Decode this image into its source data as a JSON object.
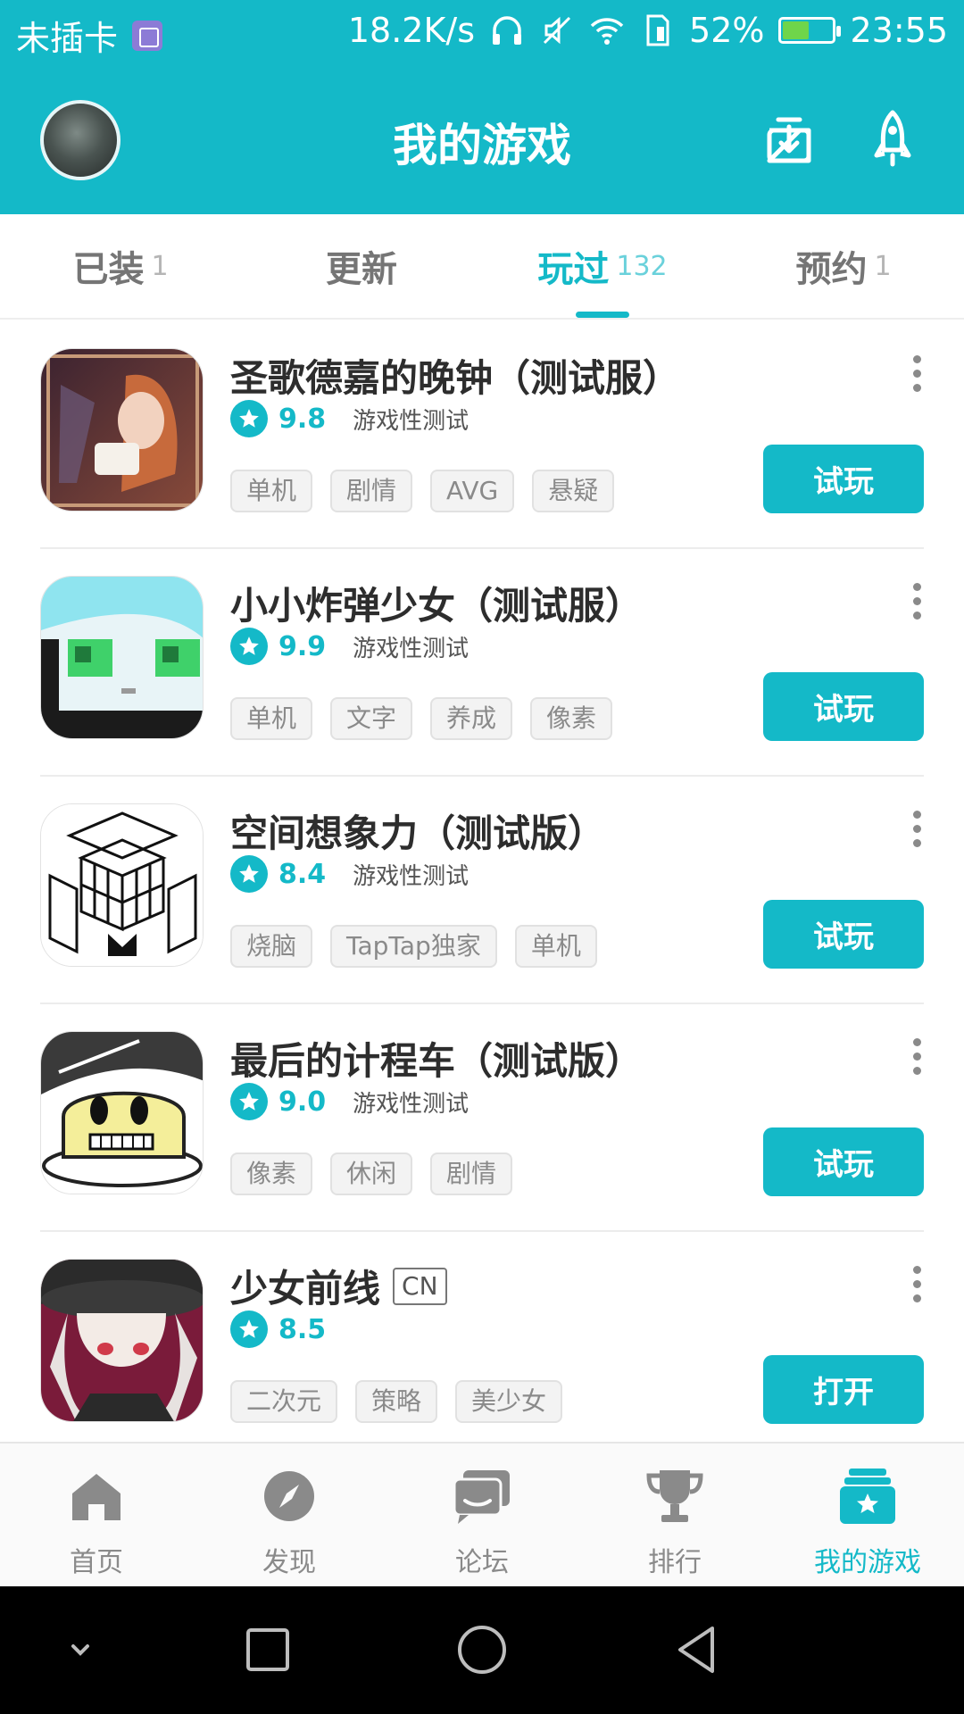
{
  "status_bar": {
    "carrier": "未插卡",
    "speed": "18.2K/s",
    "battery": "52%",
    "battery_level": 0.52,
    "time": "23:55"
  },
  "header": {
    "title": "我的游戏"
  },
  "tabs": [
    {
      "label": "已装",
      "count": "1"
    },
    {
      "label": "更新",
      "count": ""
    },
    {
      "label": "玩过",
      "count": "132",
      "active": true
    },
    {
      "label": "预约",
      "count": "1"
    }
  ],
  "games": [
    {
      "title": "圣歌德嘉的晚钟（测试服）",
      "rating": "9.8",
      "status": "游戏性测试",
      "tags": [
        "单机",
        "剧情",
        "AVG",
        "悬疑"
      ],
      "action": "试玩"
    },
    {
      "title": "小小炸弹少女（测试服）",
      "rating": "9.9",
      "status": "游戏性测试",
      "tags": [
        "单机",
        "文字",
        "养成",
        "像素"
      ],
      "action": "试玩"
    },
    {
      "title": "空间想象力（测试版）",
      "rating": "8.4",
      "status": "游戏性测试",
      "tags": [
        "烧脑",
        "TapTap独家",
        "单机"
      ],
      "action": "试玩"
    },
    {
      "title": "最后的计程车（测试版）",
      "rating": "9.0",
      "status": "游戏性测试",
      "tags": [
        "像素",
        "休闲",
        "剧情"
      ],
      "action": "试玩"
    },
    {
      "title": "少女前线",
      "badge": "CN",
      "rating": "8.5",
      "status": "",
      "tags": [
        "二次元",
        "策略",
        "美少女"
      ],
      "action": "打开"
    }
  ],
  "bottom_nav": [
    {
      "label": "首页",
      "icon": "home-icon"
    },
    {
      "label": "发现",
      "icon": "compass-icon"
    },
    {
      "label": "论坛",
      "icon": "forum-icon"
    },
    {
      "label": "排行",
      "icon": "trophy-icon"
    },
    {
      "label": "我的游戏",
      "icon": "my-games-icon",
      "active": true
    }
  ],
  "colors": {
    "accent": "#14b9c8",
    "text_dark": "#2d2d2d",
    "text_muted": "#8a8a8a"
  }
}
